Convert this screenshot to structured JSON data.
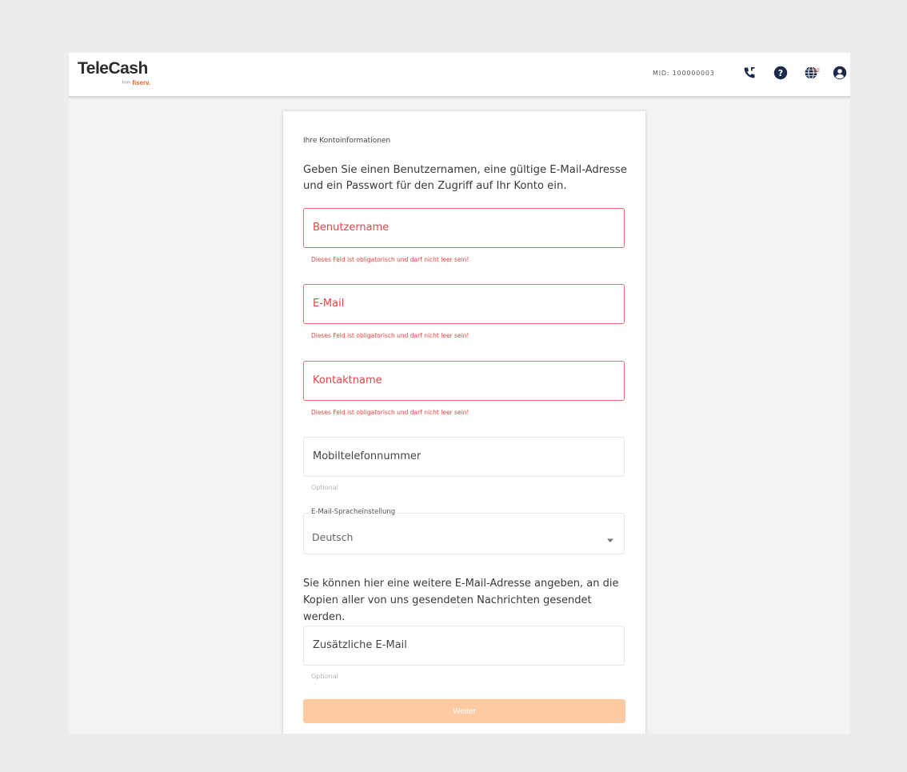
{
  "header": {
    "logo_main": "TeleCash",
    "logo_from": "from",
    "logo_brand": "fiserv.",
    "mid_label": "MID: 100000003",
    "language_code": "DE",
    "icons": [
      "phone-icon",
      "help-icon",
      "language-globe-icon",
      "user-account-icon"
    ]
  },
  "form": {
    "section_title": "Ihre Kontoinformationen",
    "intro": "Geben Sie einen Benutzernamen, eine gültige E-Mail-Adresse und ein Passwort für den Zugriff auf Ihr Konto ein.",
    "fields": {
      "username": {
        "label": "Benutzername",
        "error": "Dieses Feld ist obligatorisch und darf nicht leer sein!"
      },
      "email": {
        "label": "E-Mail",
        "error": "Dieses Feld ist obligatorisch und darf nicht leer sein!"
      },
      "contact": {
        "label": "Kontaktname",
        "error": "Dieses Feld ist obligatorisch und darf nicht leer sein!"
      },
      "mobile": {
        "label": "Mobiltelefonnummer",
        "hint": "Optional"
      },
      "language": {
        "label": "E-Mail-Spracheinstellung",
        "value": "Deutsch"
      },
      "extra_email": {
        "label": "Zusätzliche E-Mail",
        "hint": "Optional"
      }
    },
    "additional_info": "Sie können hier eine weitere E-Mail-Adresse angeben, an die Kopien aller von uns gesendeten Nachrichten gesendet werden.",
    "submit_label": "Weiter"
  },
  "colors": {
    "brand_orange": "#f26522",
    "error_red": "#e14545",
    "button_disabled": "#ffc9a2",
    "icon_navy": "#1b2a4a"
  }
}
